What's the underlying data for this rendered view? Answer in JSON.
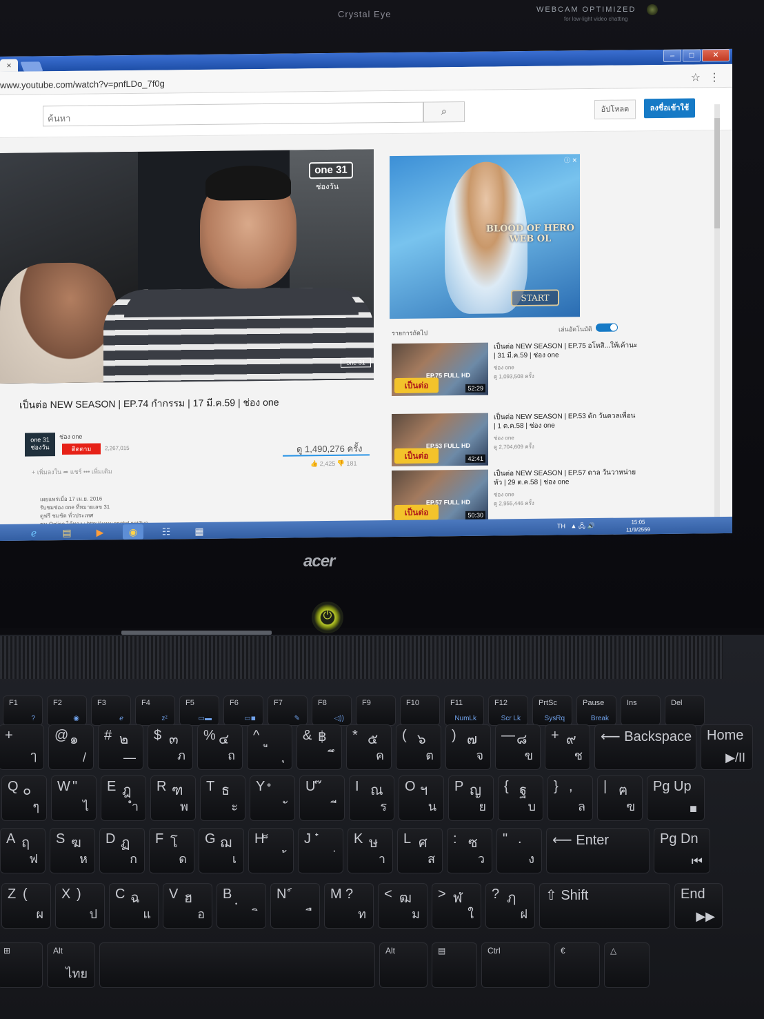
{
  "bezel": {
    "left_label": "Crystal Eye",
    "right_label": "WEBCAM OPTIMIZED",
    "right_sub": "for low-light video chatting"
  },
  "browser": {
    "tab_close": "×",
    "url": "www.youtube.com/watch?v=pnfLDo_7f0g",
    "win_min": "–",
    "win_max": "□",
    "win_close": "✕"
  },
  "youtube": {
    "search_placeholder": "ค้นหา",
    "upload_label": "อัปโหลด",
    "signin_label": "ลงชื่อเข้าใช้",
    "player": {
      "logo": "one 31",
      "logo_sub": "ช่องวัน",
      "logo_small": "one 31"
    },
    "video": {
      "title": "เป็นต่อ NEW SEASON | EP.74 กำกรรม | 17 มี.ค.59 | ช่อง one",
      "channel_logo": "one 31 ช่องวัน",
      "channel": "ช่อง one",
      "subscribe": "ติดตาม",
      "sub_count": "2,267,015",
      "views": "ดู 1,490,276 ครั้ง",
      "actions": "+ เพิ่มลงใน  ➦ แชร์  ••• เพิ่มเติม",
      "likes": "👍 2,425   👎 181",
      "description": [
        "เผยแพร่เมื่อ 17 เม.ย. 2016",
        "รับชมช่อง one ที่หมายเลข 31",
        "ดูฟรี ชมชัด ทั่วประเทศ",
        "ชม Online ได้ทาง : http://www.onehd.net/live"
      ]
    },
    "ad": {
      "title_line1": "BLOOD OF HERO",
      "title_line2": "WEB OL",
      "start": "START",
      "close": "ⓘ ✕"
    },
    "up_next": "รายการถัดไป",
    "autoplay": "เล่นอัตโนมัติ",
    "related": [
      {
        "title": "เป็นต่อ NEW SEASON | EP.75 อโหสิ...ให้เค้านะ | 31 มี.ค.59 | ช่อง one",
        "channel": "ช่อง one",
        "views": "ดู 1,093,508 ครั้ง",
        "ep": "EP.75 FULL HD",
        "tag": "เป็นต่อ",
        "duration": "52:29"
      },
      {
        "title": "เป็นต่อ NEW SEASON | EP.53 ตัก วันดวลเพื่อน | 1 ต.ค.58 | ช่อง one",
        "channel": "ช่อง one",
        "views": "ดู 2,704,609 ครั้ง",
        "ep": "EP.53 FULL HD",
        "tag": "เป็นต่อ",
        "duration": "42:41"
      },
      {
        "title": "เป็นต่อ NEW SEASON | EP.57 ดาล วันวาหน่ายหัว | 29 ต.ค.58 | ช่อง one",
        "channel": "ช่อง one",
        "views": "ดู 2,955,446 ครั้ง",
        "ep": "EP.57 FULL HD",
        "tag": "เป็นต่อ",
        "duration": "50:30"
      }
    ]
  },
  "taskbar": {
    "lang": "TH",
    "tray_icons": "▲ 🖧 🔊",
    "time": "15:05",
    "date": "11/9/2559"
  },
  "laptop": {
    "brand": "acer",
    "power": "⏻"
  },
  "keyboard": {
    "fn_row": [
      {
        "a": "F1",
        "c": "?"
      },
      {
        "a": "F2",
        "c": "◉"
      },
      {
        "a": "F3",
        "c": "ℯ"
      },
      {
        "a": "F4",
        "c": "zᶻ"
      },
      {
        "a": "F5",
        "c": "▭▬"
      },
      {
        "a": "F6",
        "c": "▭◾"
      },
      {
        "a": "F7",
        "c": "✎"
      },
      {
        "a": "F8",
        "c": "◁))"
      },
      {
        "a": "F9",
        "c": ""
      },
      {
        "a": "F10",
        "c": ""
      },
      {
        "a": "F11",
        "c": "NumLk"
      },
      {
        "a": "F12",
        "c": "Scr Lk"
      },
      {
        "a": "PrtSc",
        "c": "SysRq"
      },
      {
        "a": "Pause",
        "c": "Break"
      },
      {
        "a": "Ins",
        "c": ""
      },
      {
        "a": "Del",
        "c": ""
      }
    ],
    "num_row": [
      {
        "a": "+",
        "b": "",
        "c": "ๅ"
      },
      {
        "a": "@",
        "b": "๑",
        "c": "/"
      },
      {
        "a": "#",
        "b": "๒",
        "c": "—"
      },
      {
        "a": "$",
        "b": "๓",
        "c": "ภ"
      },
      {
        "a": "%",
        "b": "๔",
        "c": "ถ"
      },
      {
        "a": "^",
        "b": "ู",
        "c": "ุ"
      },
      {
        "a": "&",
        "b": "฿",
        "c": "ึ"
      },
      {
        "a": "*",
        "b": "๕",
        "c": "ค"
      },
      {
        "a": "(",
        "b": "๖",
        "c": "ต"
      },
      {
        "a": ")",
        "b": "๗",
        "c": "จ"
      },
      {
        "a": "—",
        "b": "๘",
        "c": "ข"
      },
      {
        "a": "+",
        "b": "๙",
        "c": "ช"
      },
      {
        "a": "⟵ Backspace",
        "b": "",
        "c": ""
      },
      {
        "a": "Home",
        "b": "",
        "c": "▶/II"
      }
    ],
    "q_row": [
      {
        "a": "Q",
        "b": "๐",
        "c": "ๆ"
      },
      {
        "a": "W",
        "b": "\"",
        "c": "ไ"
      },
      {
        "a": "E",
        "b": "ฎ",
        "c": "ำ"
      },
      {
        "a": "R",
        "b": "ฑ",
        "c": "พ"
      },
      {
        "a": "T",
        "b": "ธ",
        "c": "ะ"
      },
      {
        "a": "Y",
        "b": "ํ",
        "c": "ั"
      },
      {
        "a": "U",
        "b": "๊",
        "c": "ี"
      },
      {
        "a": "I",
        "b": "ณ",
        "c": "ร"
      },
      {
        "a": "O",
        "b": "ฯ",
        "c": "น"
      },
      {
        "a": "P",
        "b": "ญ",
        "c": "ย"
      },
      {
        "a": "{",
        "b": "ฐ",
        "c": "บ"
      },
      {
        "a": "}",
        "b": ",",
        "c": "ล"
      },
      {
        "a": "|",
        "b": "ฅ",
        "c": "ฃ"
      },
      {
        "a": "Pg Up",
        "b": "",
        "c": "■"
      }
    ],
    "a_row": [
      {
        "a": "A",
        "b": "ฤ",
        "c": "ฟ"
      },
      {
        "a": "S",
        "b": "ฆ",
        "c": "ห"
      },
      {
        "a": "D",
        "b": "ฏ",
        "c": "ก"
      },
      {
        "a": "F",
        "b": "โ",
        "c": "ด"
      },
      {
        "a": "G",
        "b": "ฌ",
        "c": "เ"
      },
      {
        "a": "H",
        "b": "็",
        "c": "้"
      },
      {
        "a": "J",
        "b": "๋",
        "c": "่"
      },
      {
        "a": "K",
        "b": "ษ",
        "c": "า"
      },
      {
        "a": "L",
        "b": "ศ",
        "c": "ส"
      },
      {
        "a": ":",
        "b": "ซ",
        "c": "ว"
      },
      {
        "a": "\"",
        "b": ".",
        "c": "ง"
      },
      {
        "a": "⟵ Enter",
        "b": "",
        "c": ""
      },
      {
        "a": "Pg Dn",
        "b": "",
        "c": "⏮"
      }
    ],
    "z_row": [
      {
        "a": "Z",
        "b": "(",
        "c": "ผ"
      },
      {
        "a": "X",
        "b": ")",
        "c": "ป"
      },
      {
        "a": "C",
        "b": "ฉ",
        "c": "แ"
      },
      {
        "a": "V",
        "b": "ฮ",
        "c": "อ"
      },
      {
        "a": "B",
        "b": "ฺ",
        "c": "ิ"
      },
      {
        "a": "N",
        "b": "์",
        "c": "ื"
      },
      {
        "a": "M",
        "b": "?",
        "c": "ท"
      },
      {
        "a": "<",
        "b": "ฒ",
        "c": "ม"
      },
      {
        "a": ">",
        "b": "ฬ",
        "c": "ใ"
      },
      {
        "a": "?",
        "b": "ฦ",
        "c": "ฝ"
      },
      {
        "a": "⇧ Shift",
        "b": "",
        "c": ""
      },
      {
        "a": "End",
        "b": "",
        "c": "▶▶"
      }
    ],
    "bottom_row": [
      {
        "a": "⊞",
        "b": "",
        "c": ""
      },
      {
        "a": "Alt",
        "b": "",
        "c": "ไทย"
      },
      {
        "a": "",
        "b": "",
        "c": ""
      },
      {
        "a": "Alt",
        "b": "",
        "c": ""
      },
      {
        "a": "▤",
        "b": "",
        "c": ""
      },
      {
        "a": "Ctrl",
        "b": "",
        "c": ""
      },
      {
        "a": "€",
        "b": "",
        "c": ""
      },
      {
        "a": "△",
        "b": "",
        "c": ""
      }
    ]
  }
}
